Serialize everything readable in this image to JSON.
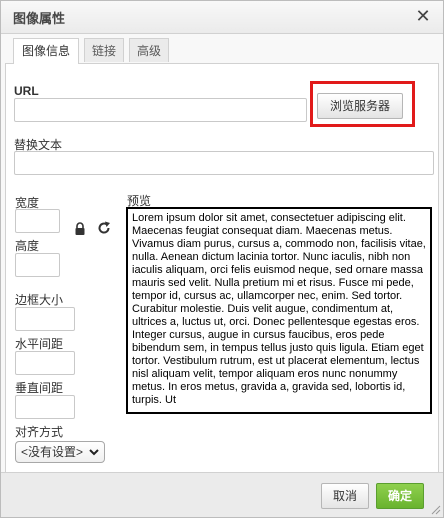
{
  "dialog": {
    "title": "图像属性",
    "close_icon": "close-icon",
    "close_glyph": "✕"
  },
  "tabs": [
    {
      "label": "图像信息",
      "active": true
    },
    {
      "label": "链接",
      "active": false
    },
    {
      "label": "高级",
      "active": false
    }
  ],
  "form": {
    "url_label": "URL",
    "url_value": "",
    "browse_label": "浏览服务器",
    "alt_label": "替换文本",
    "alt_value": "",
    "width_label": "宽度",
    "width_value": "",
    "height_label": "高度",
    "height_value": "",
    "border_label": "边框大小",
    "border_value": "",
    "hspace_label": "水平间距",
    "hspace_value": "",
    "vspace_label": "垂直间距",
    "vspace_value": "",
    "align_label": "对齐方式",
    "align_selected": "<没有设置>",
    "lock_icon": "lock-icon",
    "reset_icon": "refresh-icon"
  },
  "preview": {
    "label": "预览",
    "text": "Lorem ipsum dolor sit amet, consectetuer adipiscing elit. Maecenas feugiat consequat diam. Maecenas metus. Vivamus diam purus, cursus a, commodo non, facilisis vitae, nulla. Aenean dictum lacinia tortor. Nunc iaculis, nibh non iaculis aliquam, orci felis euismod neque, sed ornare massa mauris sed velit. Nulla pretium mi et risus. Fusce mi pede, tempor id, cursus ac, ullamcorper nec, enim. Sed tortor. Curabitur molestie. Duis velit augue, condimentum at, ultrices a, luctus ut, orci. Donec pellentesque egestas eros. Integer cursus, augue in cursus faucibus, eros pede bibendum sem, in tempus tellus justo quis ligula. Etiam eget tortor. Vestibulum rutrum, est ut placerat elementum, lectus nisl aliquam velit, tempor aliquam eros nunc nonummy metus. In eros metus, gravida a, gravida sed, lobortis id, turpis. Ut"
  },
  "footer": {
    "cancel_label": "取消",
    "ok_label": "确定"
  },
  "colors": {
    "ok_button": "#69b32e",
    "highlight_box": "#e11a1a"
  }
}
